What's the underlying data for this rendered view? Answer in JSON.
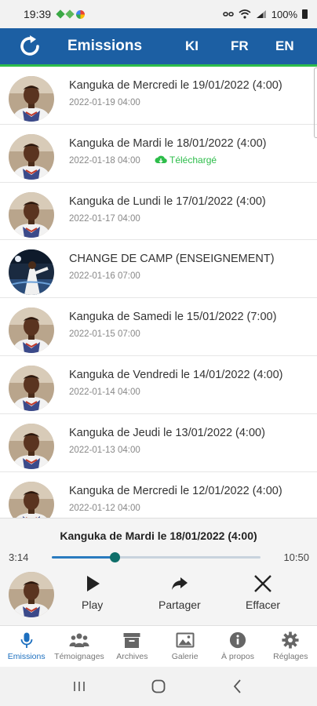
{
  "status": {
    "time": "19:39",
    "battery": "100%"
  },
  "appbar": {
    "title": "Emissions",
    "languages": [
      "KI",
      "FR",
      "EN"
    ]
  },
  "colors": {
    "primary": "#1c5fa3",
    "accent": "#2dbd4a",
    "active_nav": "#1c6fbf",
    "seek": "#0f6f6a"
  },
  "episodes": [
    {
      "title": "Kanguka de Mercredi le 19/01/2022 (4:00)",
      "date": "2022-01-19 04:00",
      "badge": "",
      "avatar": "preacher"
    },
    {
      "title": "Kanguka de Mardi le 18/01/2022 (4:00)",
      "date": "2022-01-18 04:00",
      "badge": "Téléchargé",
      "avatar": "preacher"
    },
    {
      "title": "Kanguka de Lundi le 17/01/2022 (4:00)",
      "date": "2022-01-17 04:00",
      "badge": "",
      "avatar": "preacher"
    },
    {
      "title": "CHANGE DE CAMP (ENSEIGNEMENT)",
      "date": "2022-01-16 07:00",
      "badge": "",
      "avatar": "stage"
    },
    {
      "title": "Kanguka de Samedi le 15/01/2022 (7:00)",
      "date": "2022-01-15 07:00",
      "badge": "",
      "avatar": "preacher"
    },
    {
      "title": "Kanguka de Vendredi le 14/01/2022 (4:00)",
      "date": "2022-01-14 04:00",
      "badge": "",
      "avatar": "preacher"
    },
    {
      "title": "Kanguka de Jeudi le 13/01/2022 (4:00)",
      "date": "2022-01-13 04:00",
      "badge": "",
      "avatar": "preacher"
    },
    {
      "title": "Kanguka de Mercredi le 12/01/2022 (4:00)",
      "date": "2022-01-12 04:00",
      "badge": "",
      "avatar": "preacher"
    }
  ],
  "player": {
    "title": "Kanguka de Mardi le 18/01/2022 (4:00)",
    "current_time": "3:14",
    "total_time": "10:50",
    "progress": 0.3,
    "controls": {
      "play": "Play",
      "share": "Partager",
      "delete": "Effacer"
    }
  },
  "nav": [
    {
      "label": "Emissions",
      "icon": "microphone-icon",
      "active": true
    },
    {
      "label": "Témoignages",
      "icon": "people-icon",
      "active": false
    },
    {
      "label": "Archives",
      "icon": "archive-box-icon",
      "active": false
    },
    {
      "label": "Galerie",
      "icon": "image-icon",
      "active": false
    },
    {
      "label": "À propos",
      "icon": "info-icon",
      "active": false
    },
    {
      "label": "Réglages",
      "icon": "gear-icon",
      "active": false
    }
  ]
}
